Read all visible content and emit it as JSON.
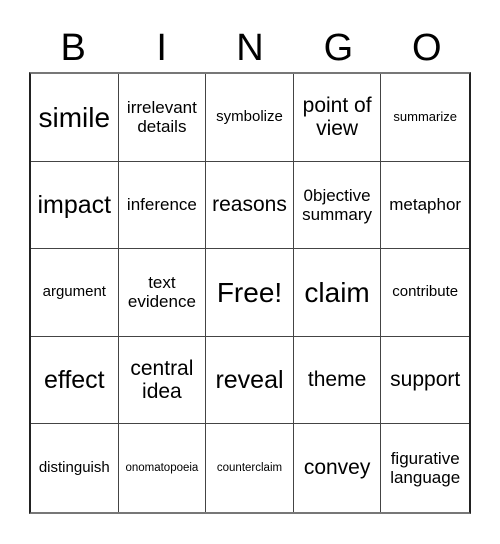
{
  "header": {
    "letters": [
      "B",
      "I",
      "N",
      "G",
      "O"
    ]
  },
  "board": {
    "rows": [
      [
        "simile",
        "irrelevant details",
        "symbolize",
        "point of view",
        "summarize"
      ],
      [
        "impact",
        "inference",
        "reasons",
        "0bjective summary",
        "metaphor"
      ],
      [
        "argument",
        "text evidence",
        "Free!",
        "claim",
        "contribute"
      ],
      [
        "effect",
        "central idea",
        "reveal",
        "theme",
        "support"
      ],
      [
        "distinguish",
        "onomatopoeia",
        "counterclaim",
        "convey",
        "figurative language"
      ]
    ],
    "free_space": "Free!"
  }
}
